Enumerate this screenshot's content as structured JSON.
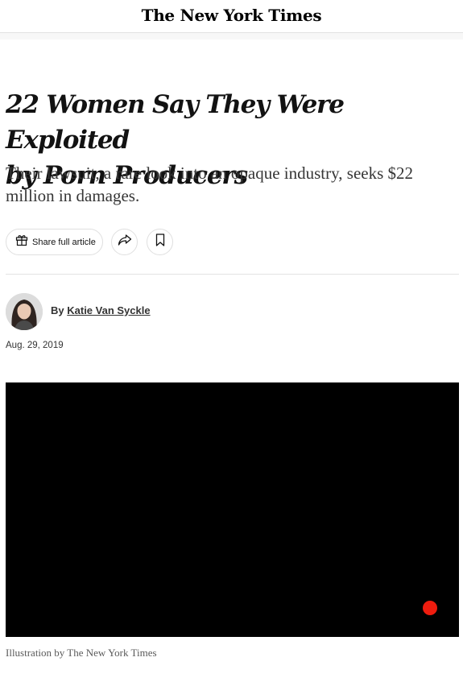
{
  "masthead": {
    "logo_text": "The New York Times"
  },
  "article": {
    "headline_line1": "22 Women Say They Were Exploited",
    "headline_line2": "by Porn Producers",
    "summary": "Their lawsuit, a rare look into an opaque industry, seeks $22 million in damages."
  },
  "actions": {
    "share_label": "Share full article",
    "icons": [
      "gift-icon",
      "share-arrow-icon",
      "bookmark-icon"
    ]
  },
  "byline": {
    "prefix": "By",
    "author": "Katie Van Syckle",
    "date": "Aug. 29, 2019"
  },
  "media": {
    "caption": "Illustration by The New York Times",
    "colors": {
      "background": "#000000",
      "dot": "#ee1c0e"
    }
  }
}
